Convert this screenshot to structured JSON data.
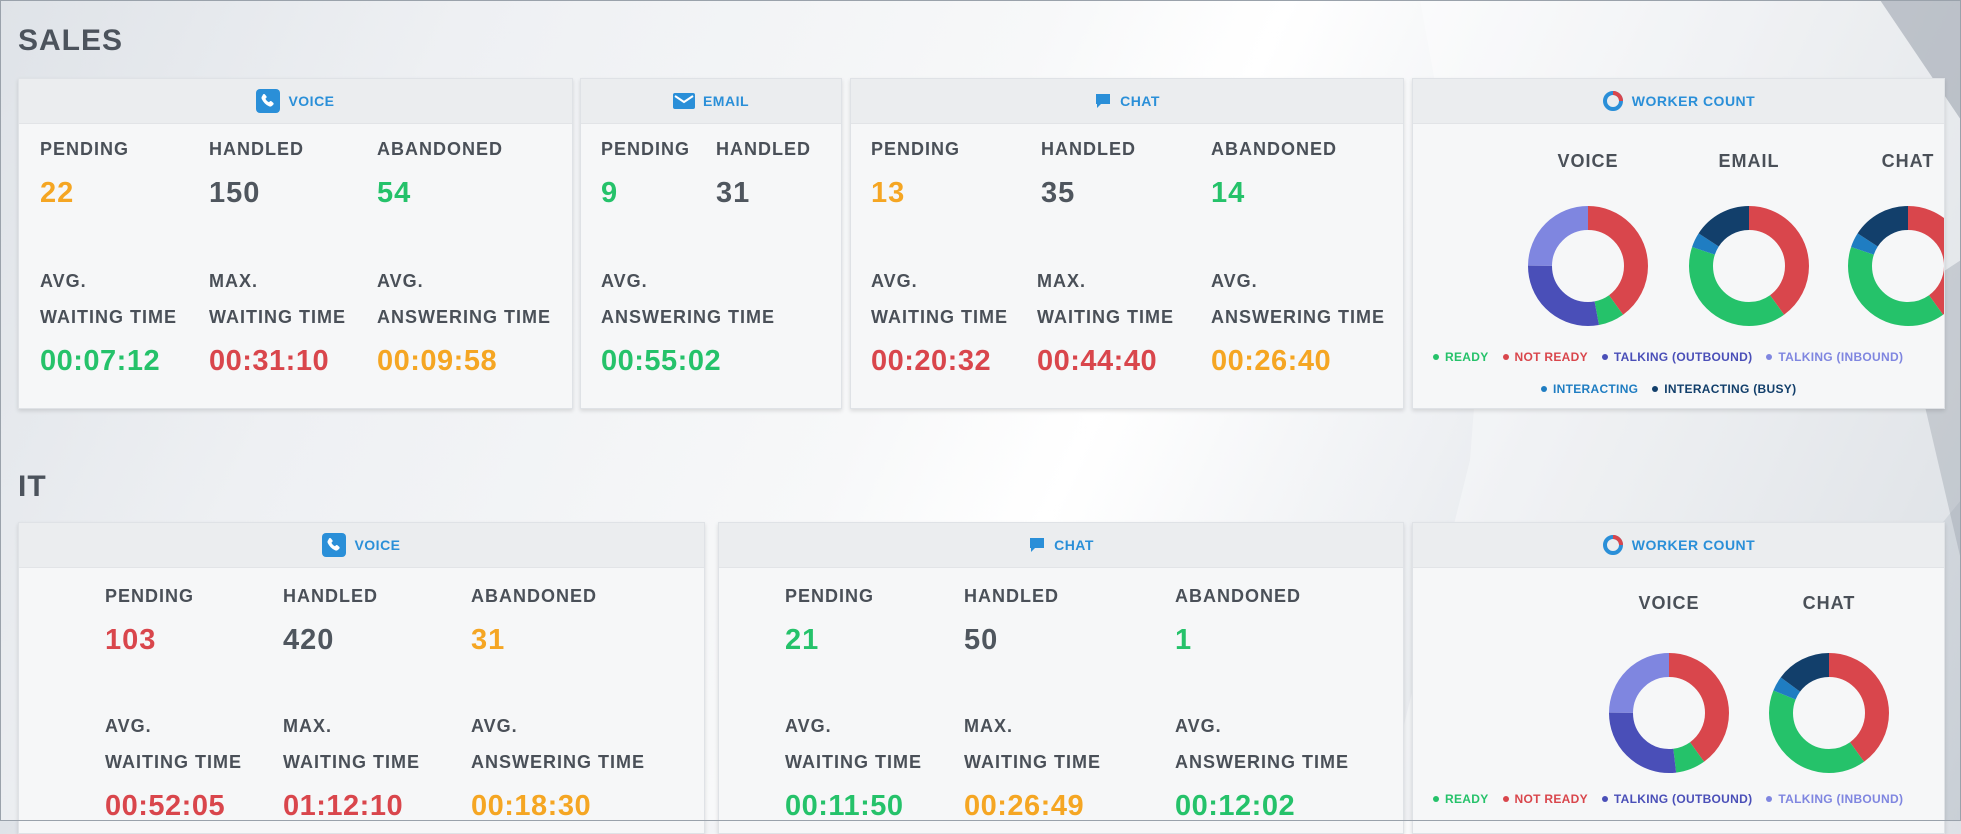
{
  "colors": {
    "green": "#25c26a",
    "red": "#d9464c",
    "orange": "#f5a623",
    "dark": "#4f565e",
    "blue": "#2a8fd8",
    "ready": "#25c26a",
    "not_ready": "#d9464c",
    "talking_outbound": "#4a4fb8",
    "talking_inbound": "#7f86e0",
    "interacting": "#1f7dc2",
    "interacting_busy": "#123f6b"
  },
  "sales": {
    "title": "SALES",
    "voice": {
      "header": "VOICE",
      "icon": "phone-icon",
      "pending_label": "PENDING",
      "pending": "22",
      "handled_label": "HANDLED",
      "handled": "150",
      "abandoned_label": "ABANDONED",
      "abandoned": "54",
      "avg_wait_label_1": "AVG.",
      "avg_wait_label_2": "WAITING TIME",
      "avg_wait": "00:07:12",
      "max_wait_label_1": "MAX.",
      "max_wait_label_2": "WAITING TIME",
      "max_wait": "00:31:10",
      "avg_answer_label_1": "AVG.",
      "avg_answer_label_2": "ANSWERING TIME",
      "avg_answer": "00:09:58"
    },
    "email": {
      "header": "EMAIL",
      "icon": "envelope-icon",
      "pending_label": "PENDING",
      "pending": "9",
      "handled_label": "HANDLED",
      "handled": "31",
      "avg_answer_label_1": "AVG.",
      "avg_answer_label_2": "ANSWERING TIME",
      "avg_answer": "00:55:02"
    },
    "chat": {
      "header": "CHAT",
      "icon": "chat-bubble-icon",
      "pending_label": "PENDING",
      "pending": "13",
      "handled_label": "HANDLED",
      "handled": "35",
      "abandoned_label": "ABANDONED",
      "abandoned": "14",
      "avg_wait_label_1": "AVG.",
      "avg_wait_label_2": "WAITING TIME",
      "avg_wait": "00:20:32",
      "max_wait_label_1": "MAX.",
      "max_wait_label_2": "WAITING TIME",
      "max_wait": "00:44:40",
      "avg_answer_label_1": "AVG.",
      "avg_answer_label_2": "ANSWERING TIME",
      "avg_answer": "00:26:40"
    },
    "workers": {
      "header": "WORKER COUNT",
      "icon": "ring-icon",
      "donuts": [
        {
          "title": "VOICE",
          "segments": [
            {
              "key": "not_ready",
              "value": 0.4
            },
            {
              "key": "ready",
              "value": 0.07
            },
            {
              "key": "talking_outbound",
              "value": 0.28
            },
            {
              "key": "talking_inbound",
              "value": 0.25
            }
          ]
        },
        {
          "title": "EMAIL",
          "segments": [
            {
              "key": "not_ready",
              "value": 0.4
            },
            {
              "key": "ready",
              "value": 0.4
            },
            {
              "key": "interacting",
              "value": 0.04
            },
            {
              "key": "interacting_busy",
              "value": 0.16
            }
          ]
        },
        {
          "title": "CHAT",
          "segments": [
            {
              "key": "not_ready",
              "value": 0.4
            },
            {
              "key": "ready",
              "value": 0.4
            },
            {
              "key": "interacting",
              "value": 0.04
            },
            {
              "key": "interacting_busy",
              "value": 0.16
            }
          ]
        }
      ],
      "legend_row1": [
        {
          "key": "ready",
          "label": "READY"
        },
        {
          "key": "not_ready",
          "label": "NOT READY"
        },
        {
          "key": "talking_outbound",
          "label": "TALKING (OUTBOUND)"
        },
        {
          "key": "talking_inbound",
          "label": "TALKING (INBOUND)"
        }
      ],
      "legend_row2": [
        {
          "key": "interacting",
          "label": "INTERACTING"
        },
        {
          "key": "interacting_busy",
          "label": "INTERACTING (BUSY)"
        }
      ]
    }
  },
  "it": {
    "title": "IT",
    "voice": {
      "header": "VOICE",
      "icon": "phone-icon",
      "pending_label": "PENDING",
      "pending": "103",
      "handled_label": "HANDLED",
      "handled": "420",
      "abandoned_label": "ABANDONED",
      "abandoned": "31",
      "avg_wait_label_1": "AVG.",
      "avg_wait_label_2": "WAITING TIME",
      "avg_wait": "00:52:05",
      "max_wait_label_1": "MAX.",
      "max_wait_label_2": "WAITING TIME",
      "max_wait": "01:12:10",
      "avg_answer_label_1": "AVG.",
      "avg_answer_label_2": "ANSWERING TIME",
      "avg_answer": "00:18:30"
    },
    "chat": {
      "header": "CHAT",
      "icon": "chat-bubble-icon",
      "pending_label": "PENDING",
      "pending": "21",
      "handled_label": "HANDLED",
      "handled": "50",
      "abandoned_label": "ABANDONED",
      "abandoned": "1",
      "avg_wait_label_1": "AVG.",
      "avg_wait_label_2": "WAITING TIME",
      "avg_wait": "00:11:50",
      "max_wait_label_1": "MAX.",
      "max_wait_label_2": "WAITING TIME",
      "max_wait": "00:26:49",
      "avg_answer_label_1": "AVG.",
      "avg_answer_label_2": "ANSWERING TIME",
      "avg_answer": "00:12:02"
    },
    "workers": {
      "header": "WORKER COUNT",
      "icon": "ring-icon",
      "donuts": [
        {
          "title": "VOICE",
          "segments": [
            {
              "key": "not_ready",
              "value": 0.4
            },
            {
              "key": "ready",
              "value": 0.08
            },
            {
              "key": "talking_outbound",
              "value": 0.27
            },
            {
              "key": "talking_inbound",
              "value": 0.25
            }
          ]
        },
        {
          "title": "CHAT",
          "segments": [
            {
              "key": "not_ready",
              "value": 0.4
            },
            {
              "key": "ready",
              "value": 0.41
            },
            {
              "key": "interacting",
              "value": 0.04
            },
            {
              "key": "interacting_busy",
              "value": 0.15
            }
          ]
        }
      ],
      "legend_row1": [
        {
          "key": "ready",
          "label": "READY"
        },
        {
          "key": "not_ready",
          "label": "NOT READY"
        },
        {
          "key": "talking_outbound",
          "label": "TALKING (OUTBOUND)"
        },
        {
          "key": "talking_inbound",
          "label": "TALKING (INBOUND)"
        }
      ]
    }
  }
}
